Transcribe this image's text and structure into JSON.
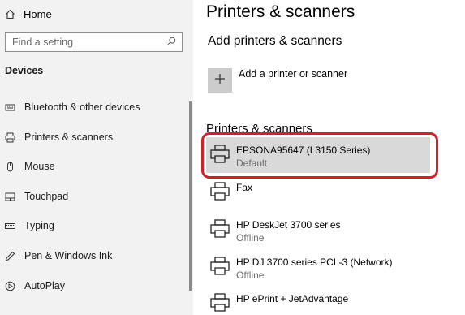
{
  "sidebar": {
    "home_label": "Home",
    "search_placeholder": "Find a setting",
    "section_title": "Devices",
    "items": [
      {
        "label": "Bluetooth & other devices",
        "icon": "bluetooth-devices-icon"
      },
      {
        "label": "Printers & scanners",
        "icon": "printer-icon"
      },
      {
        "label": "Mouse",
        "icon": "mouse-icon"
      },
      {
        "label": "Touchpad",
        "icon": "touchpad-icon"
      },
      {
        "label": "Typing",
        "icon": "keyboard-icon"
      },
      {
        "label": "Pen & Windows Ink",
        "icon": "pen-icon"
      },
      {
        "label": "AutoPlay",
        "icon": "autoplay-icon"
      }
    ]
  },
  "main": {
    "title": "Printers & scanners",
    "add_section_title": "Add printers & scanners",
    "add_label": "Add a printer or scanner",
    "list_section_title": "Printers & scanners",
    "printers": [
      {
        "name": "EPSONA95647 (L3150 Series)",
        "status": "Default"
      },
      {
        "name": "Fax",
        "status": ""
      },
      {
        "name": "HP DeskJet 3700 series",
        "status": "Offline"
      },
      {
        "name": "HP DJ 3700 series PCL-3 (Network)",
        "status": "Offline"
      },
      {
        "name": "HP ePrint + JetAdvantage",
        "status": ""
      }
    ]
  },
  "colors": {
    "sidebar_bg": "#f2f2f2",
    "selected_bg": "#d9d9d9",
    "highlight_border": "#d0212a"
  }
}
